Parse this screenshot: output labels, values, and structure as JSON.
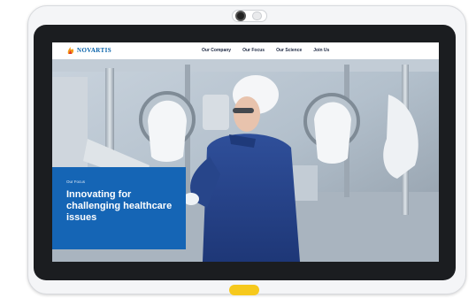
{
  "logo": {
    "text": "NOVARTIS",
    "icon": "novartis-flame-icon"
  },
  "nav": {
    "items": [
      {
        "label": "Our Company"
      },
      {
        "label": "Our Focus"
      },
      {
        "label": "Our Science"
      },
      {
        "label": "Join Us"
      }
    ]
  },
  "hero": {
    "eyebrow": "Our Focus",
    "title": "Innovating for challenging healthcare issues",
    "card_color": "#1565b5"
  },
  "device": {
    "home_button_color": "#f6c91d",
    "icon": "tablet-camera-icon"
  }
}
